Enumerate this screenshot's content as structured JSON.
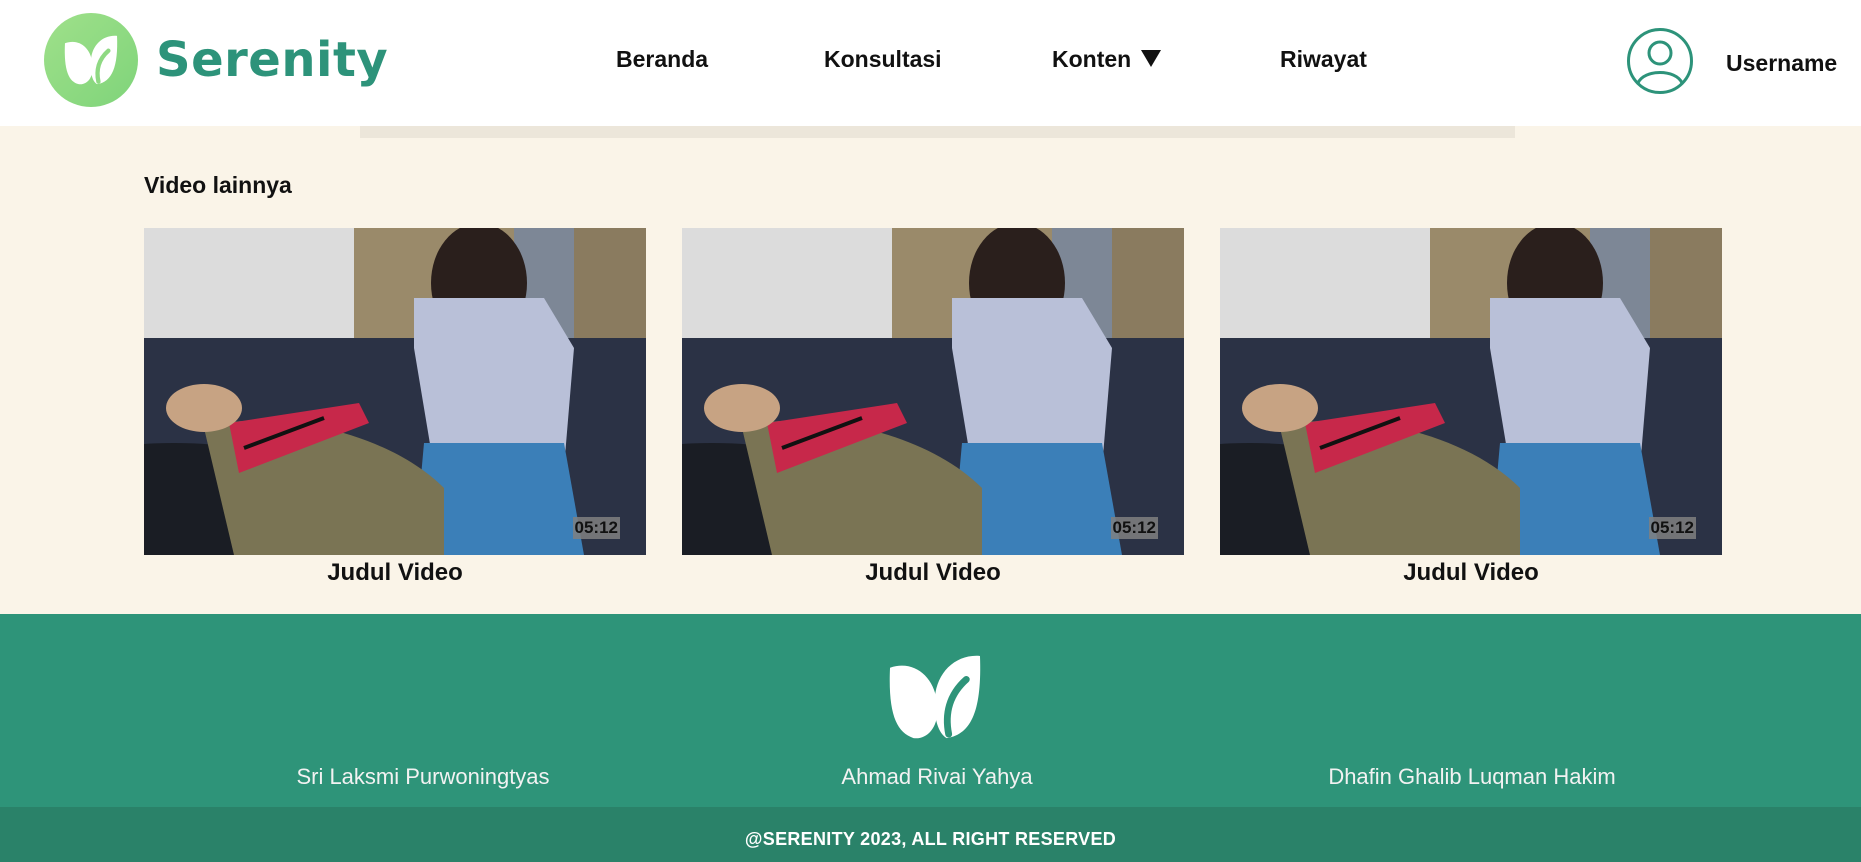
{
  "brand": {
    "name": "Serenity",
    "logo_icon": "leaf-icon",
    "color": "#2d937a"
  },
  "nav": {
    "items": [
      {
        "label": "Beranda"
      },
      {
        "label": "Konsultasi"
      },
      {
        "label": "Konten",
        "icon": "caret-down-icon"
      },
      {
        "label": "Riwayat"
      }
    ]
  },
  "user": {
    "name": "Username",
    "icon": "user-avatar-icon"
  },
  "main": {
    "section_title": "Video lainnya",
    "videos": [
      {
        "title": "Judul Video",
        "duration": "05:12"
      },
      {
        "title": "Judul Video",
        "duration": "05:12"
      },
      {
        "title": "Judul Video",
        "duration": "05:12"
      }
    ]
  },
  "footer": {
    "logo_icon": "leaf-icon",
    "credits": [
      "Sri Laksmi Purwoningtyas",
      "Ahmad Rivai Yahya",
      "Dhafin Ghalib Luqman Hakim"
    ],
    "copyright": "@SERENITY 2023, ALL RIGHT RESERVED",
    "background": "#2e9479"
  },
  "colors": {
    "page_background": "#faf4e8",
    "accent": "#2e9479"
  }
}
